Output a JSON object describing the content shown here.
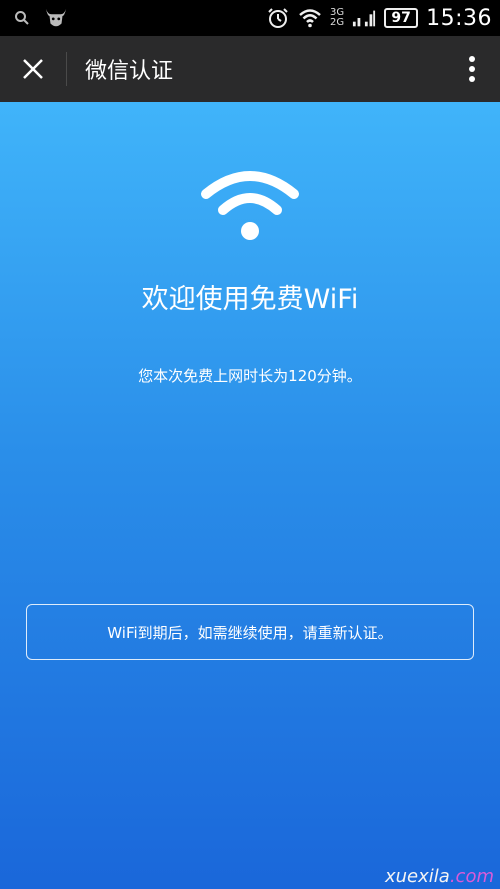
{
  "status_bar": {
    "net_top": "3G",
    "net_bottom": "2G",
    "battery": "97",
    "time": "15:36"
  },
  "titlebar": {
    "title": "微信认证"
  },
  "main": {
    "welcome": "欢迎使用免费WiFi",
    "duration": "您本次免费上网时长为120分钟。",
    "notice": "WiFi到期后，如需继续使用，请重新认证。"
  },
  "watermark": {
    "part1": "xuexila",
    "part2": ".com"
  },
  "colors": {
    "gradient_top": "#40b4fa",
    "gradient_bottom": "#1a67da",
    "titlebar_bg": "#2a2a2b",
    "statusbar_bg": "#000000"
  }
}
